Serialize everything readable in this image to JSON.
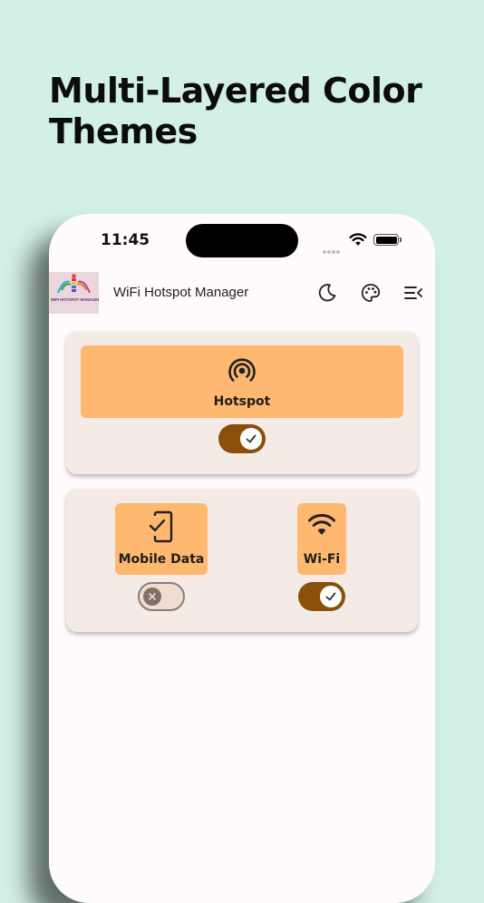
{
  "promo": {
    "title_line1": "Multi-Layered Color",
    "title_line2": "Themes"
  },
  "status_bar": {
    "time": "11:45"
  },
  "app_bar": {
    "logo_text": "WIFI HOTSPOT MANAGER",
    "title": "WiFi Hotspot Manager",
    "icons": [
      "moon-icon",
      "palette-icon",
      "menu-collapse-icon"
    ]
  },
  "hotspot_card": {
    "label": "Hotspot",
    "enabled": true
  },
  "network_card": {
    "mobile_data": {
      "label": "Mobile Data",
      "enabled": false
    },
    "wifi": {
      "label": "Wi-Fi",
      "enabled": true
    }
  },
  "colors": {
    "background": "#d3f0e5",
    "tile": "#ffb870",
    "card": "#f5ebe6",
    "toggle_on": "#8a4f0b",
    "toggle_off": "#f0dcd0"
  }
}
